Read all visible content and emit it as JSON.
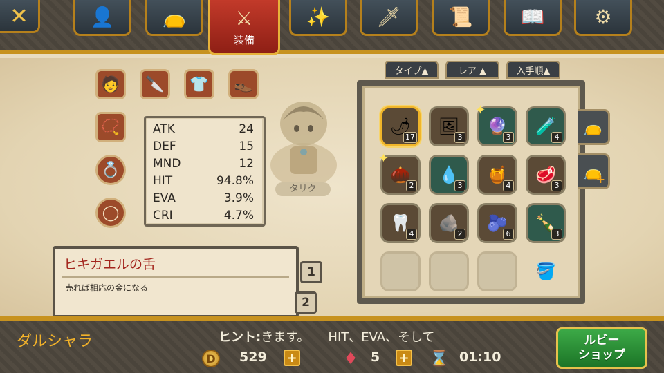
{
  "nav": {
    "close_label": "✕",
    "tabs": [
      {
        "icon": "person-icon",
        "glyph": "👤"
      },
      {
        "icon": "bag-icon",
        "glyph": "👝"
      },
      {
        "icon": "swords-icon",
        "glyph": "⚔",
        "label": "装備"
      },
      {
        "icon": "sparkles-icon",
        "glyph": "✨"
      },
      {
        "icon": "tool-icon",
        "glyph": "🗡"
      },
      {
        "icon": "scroll-icon",
        "glyph": "📜"
      },
      {
        "icon": "book-icon",
        "glyph": "📖"
      },
      {
        "icon": "gear-icon",
        "glyph": "⚙"
      }
    ]
  },
  "stats": [
    {
      "name": "ATK",
      "value": "24"
    },
    {
      "name": "DEF",
      "value": "15"
    },
    {
      "name": "MND",
      "value": "12"
    },
    {
      "name": "HIT",
      "value": "94.8%"
    },
    {
      "name": "EVA",
      "value": "3.9%"
    },
    {
      "name": "CRI",
      "value": "4.7%"
    }
  ],
  "character": {
    "name": "タリク"
  },
  "item_detail": {
    "name": "ヒキガエルの舌",
    "description": "売れば相応の金になる"
  },
  "pages": [
    "1",
    "2"
  ],
  "filters": [
    {
      "label": "タイプ▲"
    },
    {
      "label": "レア ▲"
    },
    {
      "label": "入手順▲"
    }
  ],
  "inventory": [
    {
      "icon": "tongue-icon",
      "glyph": "🌶",
      "count": "17",
      "style": "wood",
      "selected": true
    },
    {
      "icon": "portrait-icon",
      "glyph": "🖼",
      "count": "3",
      "style": "wood"
    },
    {
      "icon": "orb-icon",
      "glyph": "🔮",
      "count": "3",
      "style": "teal",
      "sparkle": true
    },
    {
      "icon": "potion-icon",
      "glyph": "🧪",
      "count": "4",
      "style": "teal"
    },
    {
      "icon": "pinecone-icon",
      "glyph": "🌰",
      "count": "2",
      "style": "wood",
      "sparkle": true
    },
    {
      "icon": "vial-icon",
      "glyph": "💧",
      "count": "3",
      "style": "teal"
    },
    {
      "icon": "scale-icon",
      "glyph": "🍯",
      "count": "4",
      "style": "wood"
    },
    {
      "icon": "meat-icon",
      "glyph": "🥩",
      "count": "3",
      "style": "wood"
    },
    {
      "icon": "fang-icon",
      "glyph": "🦷",
      "count": "4",
      "style": "wood"
    },
    {
      "icon": "ore-icon",
      "glyph": "🪨",
      "count": "2",
      "style": "wood"
    },
    {
      "icon": "slime-icon",
      "glyph": "🫐",
      "count": "6",
      "style": "wood"
    },
    {
      "icon": "bottle-icon",
      "glyph": "🍾",
      "count": "3",
      "style": "teal"
    },
    {
      "icon": "",
      "glyph": "",
      "count": "",
      "style": "empty"
    },
    {
      "icon": "",
      "glyph": "",
      "count": "",
      "style": "empty"
    },
    {
      "icon": "",
      "glyph": "",
      "count": "",
      "style": "empty"
    },
    {
      "icon": "pot-icon",
      "glyph": "🪣",
      "count": "",
      "style": "none"
    }
  ],
  "footer": {
    "location": "ダルシャラ",
    "hint_label": "ヒント:",
    "hint_text": "きます。　　HIT、EVA、そして",
    "gold": "529",
    "rubies": "5",
    "timer": "01:10",
    "ruby_shop_line1": "ルビー",
    "ruby_shop_line2": "ショップ"
  },
  "colors": {
    "accent": "#c7921f",
    "active_tab": "#c23a2a",
    "shop": "#2e9a3a"
  }
}
